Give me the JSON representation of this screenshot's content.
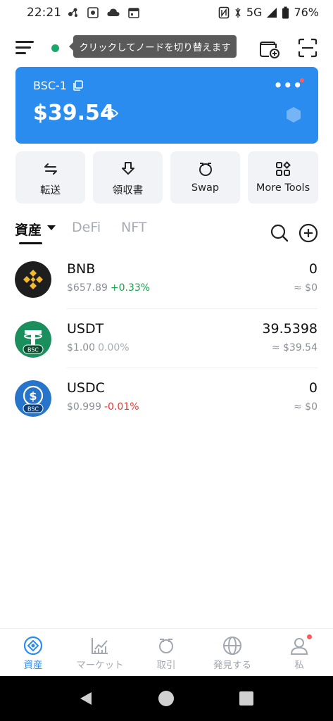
{
  "status_bar": {
    "time": "22:21",
    "network": "5G",
    "battery": "76%"
  },
  "header": {
    "tooltip": "クリックしてノードを切り替えます",
    "node_status_color": "#1ba96b"
  },
  "wallet": {
    "name": "BSC-1",
    "balance": "$39.54",
    "card_color": "#2b8cf0"
  },
  "actions": [
    {
      "label": "転送",
      "icon": "transfer-icon"
    },
    {
      "label": "領収書",
      "icon": "receive-icon"
    },
    {
      "label": "Swap",
      "icon": "swap-icon"
    },
    {
      "label": "More Tools",
      "icon": "grid-icon"
    }
  ],
  "tabs": {
    "assets": "資産",
    "defi": "DeFi",
    "nft": "NFT"
  },
  "tokens": [
    {
      "symbol": "BNB",
      "price": "$657.89",
      "change": "+0.33%",
      "change_color": "#16a34a",
      "amount": "0",
      "value": "≈ $0",
      "logo_color": "#1e1e1e"
    },
    {
      "symbol": "USDT",
      "price": "$1.00",
      "change": "0.00%",
      "change_color": "#a7acb4",
      "amount": "39.5398",
      "value": "≈ $39.54",
      "logo_color": "#1a8f5d"
    },
    {
      "symbol": "USDC",
      "price": "$0.999",
      "change": "-0.01%",
      "change_color": "#e53935",
      "amount": "0",
      "value": "≈ $0",
      "logo_color": "#2775ca"
    }
  ],
  "token_logo_text": {
    "bsc": "BSC"
  },
  "bottom_nav": [
    {
      "label": "資産",
      "icon": "assets-icon",
      "active": true
    },
    {
      "label": "マーケット",
      "icon": "market-icon",
      "active": false
    },
    {
      "label": "取引",
      "icon": "trade-icon",
      "active": false
    },
    {
      "label": "発見する",
      "icon": "discover-icon",
      "active": false
    },
    {
      "label": "私",
      "icon": "profile-icon",
      "active": false
    }
  ],
  "colors": {
    "accent": "#2b8cf0",
    "positive": "#16a34a",
    "negative": "#e53935"
  }
}
